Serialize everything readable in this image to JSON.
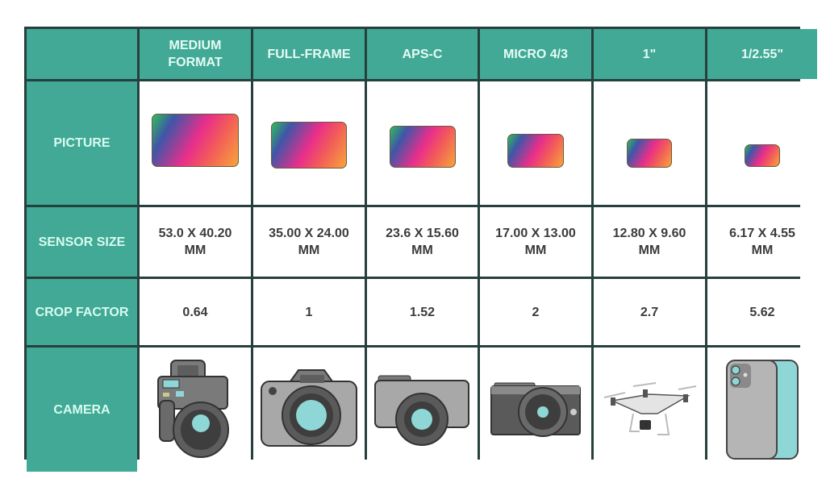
{
  "columns": [
    "MEDIUM FORMAT",
    "FULL-FRAME",
    "APS-C",
    "MICRO 4/3",
    "1\"",
    "1/2.55\""
  ],
  "row_labels": {
    "picture": "PICTURE",
    "sensor_size": "SENSOR SIZE",
    "crop_factor": "CROP FACTOR",
    "camera": "CAMERA"
  },
  "sensor_sizes": [
    "53.0 X 40.20 MM",
    "35.00 X 24.00 MM",
    "23.6 X 15.60 MM",
    "17.00 X 13.00 MM",
    "12.80 X 9.60 MM",
    "6.17 X 4.55 MM"
  ],
  "crop_factors": [
    "0.64",
    "1",
    "1.52",
    "2",
    "2.7",
    "5.62"
  ],
  "camera_icons": [
    "medium-format-camera-icon",
    "dslr-camera-icon",
    "mirrorless-camera-icon",
    "compact-camera-icon",
    "drone-icon",
    "smartphone-icon"
  ],
  "colors": {
    "header_bg": "#41a996",
    "border": "#26403d",
    "text": "#3b3b3b"
  }
}
